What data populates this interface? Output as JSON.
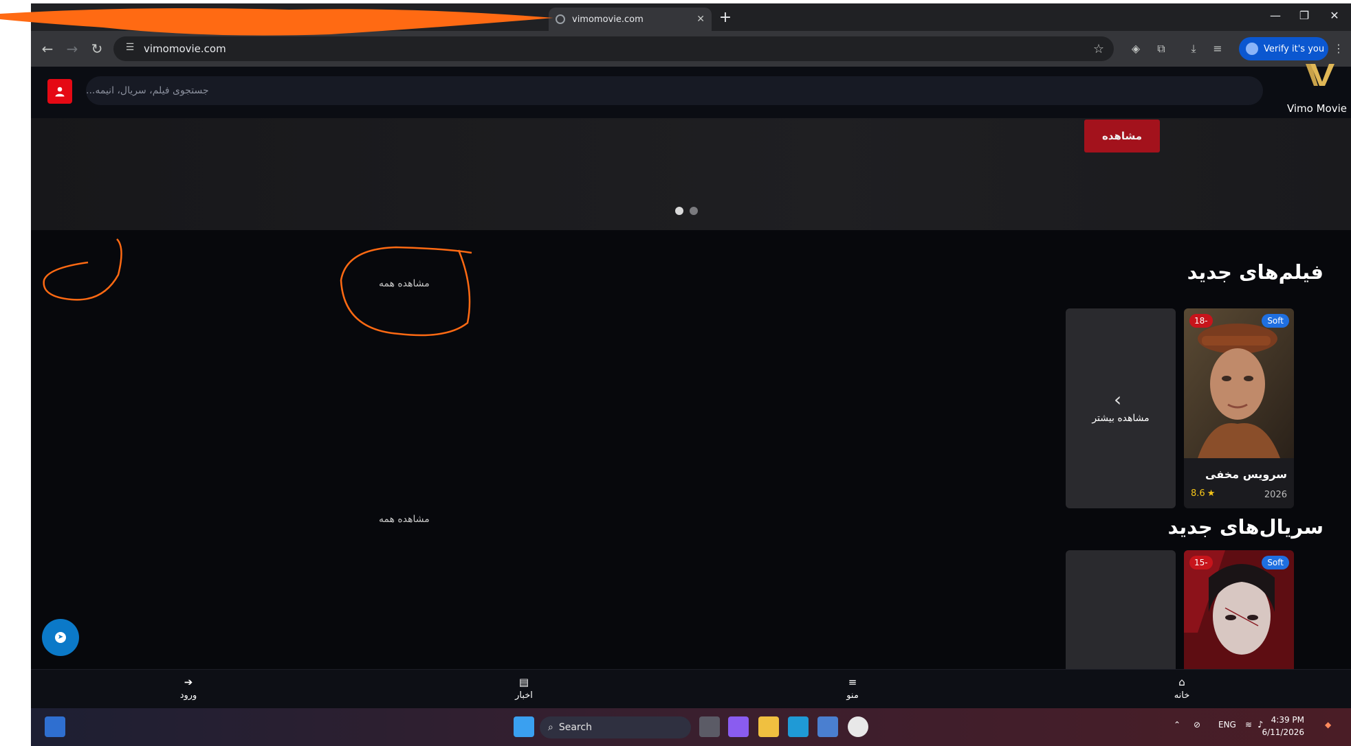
{
  "browser": {
    "tab_title": "vimomovie.com",
    "url": "vimomovie.com",
    "verify_label": "Verify it's you"
  },
  "site": {
    "brand": "Vimo Movie",
    "search_placeholder": "جستجوی فیلم، سریال، انیمه...",
    "hero_button": "مشاهده",
    "slides": 2,
    "active_slide": 1,
    "sections": [
      {
        "title": "فیلم‌های جدید",
        "see_all": "مشاهده همه",
        "cards": [
          {
            "title": "سرویس مخفی",
            "year": "2026",
            "rating": "8.6",
            "badge": "Soft",
            "age": "18-"
          }
        ],
        "more_label": "مشاهده بیشتر"
      },
      {
        "title": "سریال‌های جدید",
        "see_all": "مشاهده همه",
        "cards": [
          {
            "badge": "Soft",
            "age": "15-"
          }
        ]
      }
    ],
    "bottom_nav": [
      {
        "label": "ورود",
        "icon": "login-icon"
      },
      {
        "label": "اخبار",
        "icon": "news-icon"
      },
      {
        "label": "منو",
        "icon": "menu-icon"
      },
      {
        "label": "خانه",
        "icon": "home-icon"
      }
    ]
  },
  "taskbar": {
    "search_label": "Search",
    "lang": "ENG",
    "time": "4:39 PM",
    "date": "6/11/2026"
  },
  "colors": {
    "accent": "#e50914",
    "soft_badge": "#1f6fe0",
    "annotation": "#ff6a13"
  }
}
